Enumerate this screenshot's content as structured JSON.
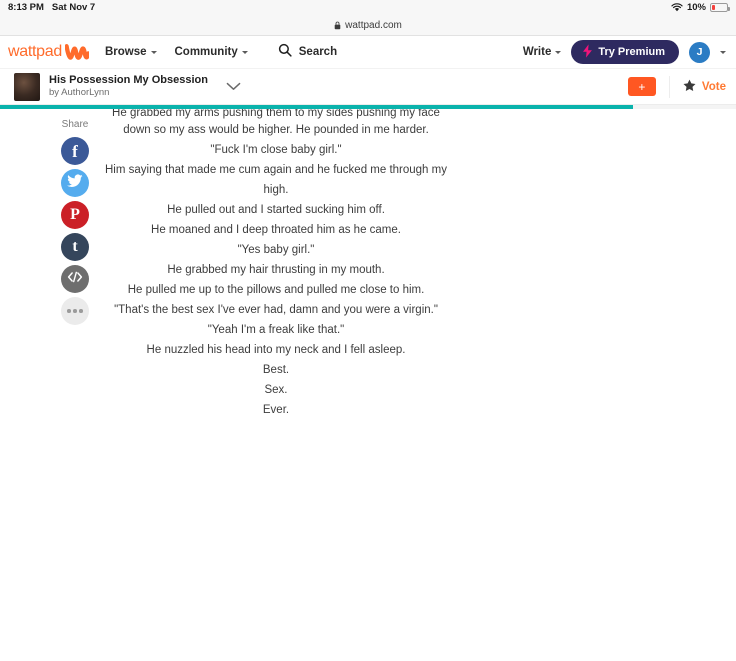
{
  "status_bar": {
    "time": "8:13 PM",
    "date": "Sat Nov 7",
    "wifi_icon": "wifi-icon",
    "battery_percent": "10%",
    "battery_icon": "battery-icon"
  },
  "browser": {
    "lock_icon": "lock-icon",
    "url": "wattpad.com"
  },
  "topnav": {
    "brand_word": "wattpad",
    "brand_mark_icon": "wattpad-w-logo-icon",
    "browse_label": "Browse",
    "community_label": "Community",
    "search_icon": "search-icon",
    "search_label": "Search",
    "write_label": "Write",
    "premium_label": "Try Premium",
    "premium_icon": "lightning-bolt-icon",
    "premium_bg_color": "#2e2a60",
    "premium_icon_color": "#f2147a",
    "avatar_initial": "J",
    "avatar_color": "#2b7cc4",
    "chevron_icon": "chevron-down-icon"
  },
  "story_bar": {
    "cover_image": "story-cover-thumbnail",
    "title": "His Possession My Obsession",
    "author": "by AuthorLynn",
    "expand_icon": "chevron-down-icon",
    "add_label": "+",
    "add_color": "#ff5722",
    "star_icon": "star-icon",
    "vote_label": "Vote",
    "vote_color": "#ff7a33"
  },
  "progress": {
    "percent": 86,
    "fill_color": "#0ab3ac",
    "track_color": "#f4f4f4"
  },
  "share": {
    "label": "Share",
    "buttons": [
      {
        "name": "facebook",
        "glyph": "f",
        "color": "#3b5998"
      },
      {
        "name": "twitter",
        "glyph": "twitter-bird-icon",
        "color": "#55acee"
      },
      {
        "name": "pinterest",
        "glyph": "pinterest-p-icon",
        "color": "#cb2027"
      },
      {
        "name": "tumblr",
        "glyph": "t",
        "color": "#35465c"
      },
      {
        "name": "embed",
        "glyph": "</>",
        "color": "#6e6e6e"
      },
      {
        "name": "more",
        "glyph": "•••",
        "color": "#ebebeb"
      }
    ]
  },
  "story_text": {
    "lines": [
      "He grabbed my arms pushing them to my sides pushing my face",
      "down so my ass would be higher. He pounded in me harder.",
      "\"Fuck I'm close baby girl.\"",
      "Him saying that made me cum again and he fucked me through my",
      "high.",
      "He pulled out and I started sucking him off.",
      "He moaned and I deep throated him as he came.",
      "\"Yes baby girl.\"",
      "He grabbed my hair thrusting in my mouth.",
      "He pulled me up to the pillows and pulled me close to him.",
      "\"That's the best sex I've ever had, damn and you were a virgin.\"",
      "\"Yeah I'm a freak like that.\"",
      "He nuzzled his head into my neck and I fell asleep.",
      "Best.",
      "Sex.",
      "Ever."
    ]
  }
}
